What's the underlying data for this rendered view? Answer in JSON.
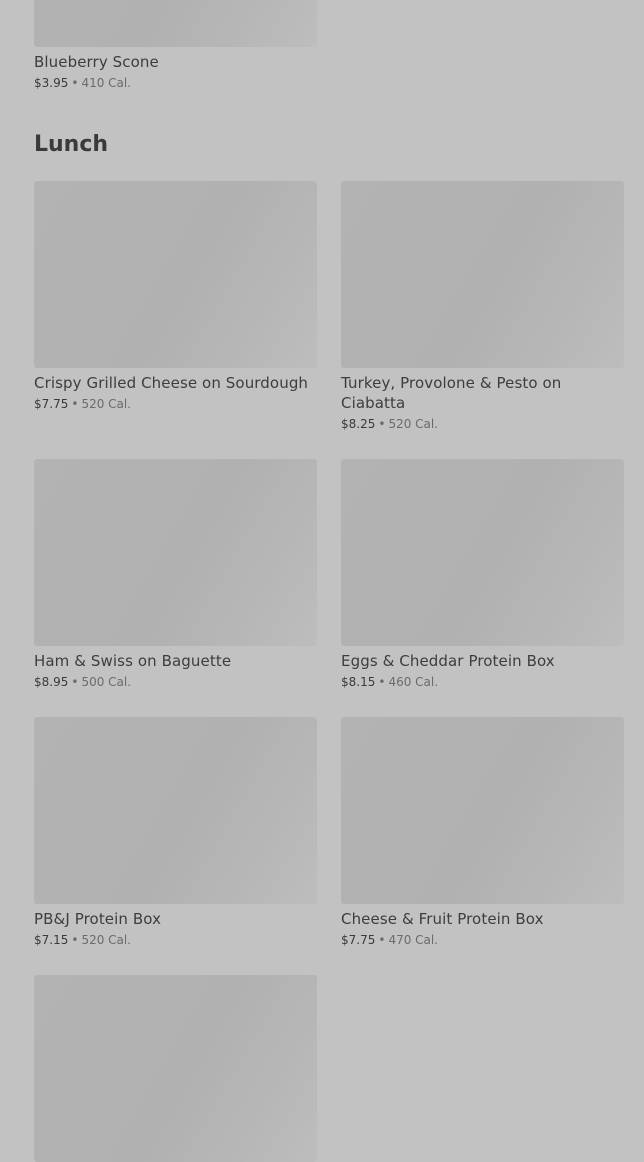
{
  "top_item": {
    "name": "Blueberry Scone",
    "price": "$3.95",
    "calories": "410 Cal."
  },
  "section": {
    "title": "Lunch"
  },
  "items": [
    {
      "name": "Crispy Grilled Cheese on Sourdough",
      "price": "$7.75",
      "calories": "520 Cal."
    },
    {
      "name": "Turkey, Provolone & Pesto on Ciabatta",
      "price": "$8.25",
      "calories": "520 Cal."
    },
    {
      "name": "Ham & Swiss on Baguette",
      "price": "$8.95",
      "calories": "500 Cal."
    },
    {
      "name": "Eggs & Cheddar Protein Box",
      "price": "$8.15",
      "calories": "460 Cal."
    },
    {
      "name": "PB&J Protein Box",
      "price": "$7.15",
      "calories": "520 Cal."
    },
    {
      "name": "Cheese & Fruit Protein Box",
      "price": "$7.75",
      "calories": "470 Cal."
    }
  ],
  "separator": "•"
}
